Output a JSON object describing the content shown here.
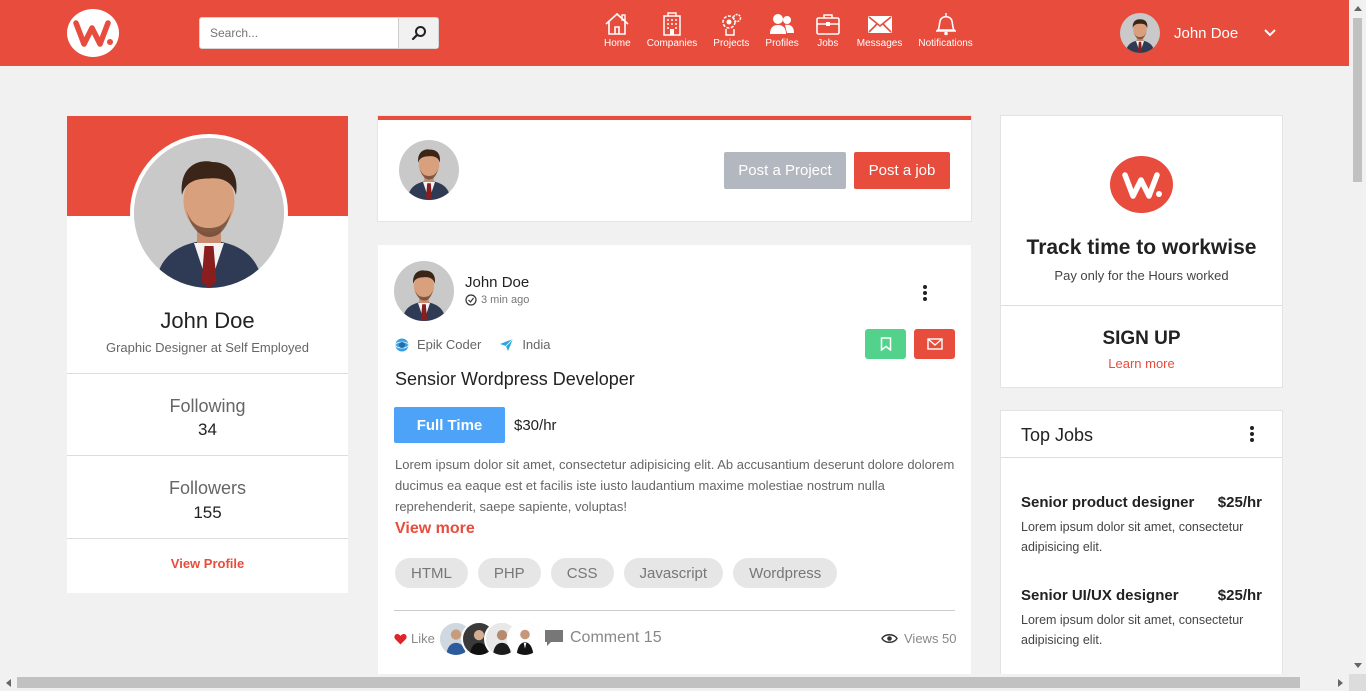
{
  "header": {
    "search_placeholder": "Search...",
    "nav": [
      {
        "label": "Home",
        "icon": "home-icon"
      },
      {
        "label": "Companies",
        "icon": "building-icon"
      },
      {
        "label": "Projects",
        "icon": "projects-icon"
      },
      {
        "label": "Profiles",
        "icon": "users-icon"
      },
      {
        "label": "Jobs",
        "icon": "briefcase-icon"
      },
      {
        "label": "Messages",
        "icon": "mail-icon"
      },
      {
        "label": "Notifications",
        "icon": "bell-icon"
      }
    ],
    "user_name": "John Doe"
  },
  "profile": {
    "name": "John Doe",
    "title": "Graphic Designer at Self Employed",
    "following_label": "Following",
    "following_count": "34",
    "followers_label": "Followers",
    "followers_count": "155",
    "view_profile": "View Profile"
  },
  "composer": {
    "post_project": "Post a Project",
    "post_job": "Post a job"
  },
  "post": {
    "author": "John Doe",
    "time": "3 min ago",
    "company": "Epik Coder",
    "location": "India",
    "title": "Sensior Wordpress Developer",
    "job_type": "Full Time",
    "rate": "$30/hr",
    "description": "Lorem ipsum dolor sit amet, consectetur adipisicing elit. Ab accusantium deserunt dolore dolorem ducimus ea eaque est et facilis iste iusto laudantium maxime molestiae nostrum nulla reprehenderit, saepe sapiente, voluptas!",
    "view_more": "View more",
    "tags": [
      "HTML",
      "PHP",
      "CSS",
      "Javascript",
      "Wordpress"
    ],
    "like_label": "Like",
    "comment_label": "Comment 15",
    "views_label": "Views 50"
  },
  "track": {
    "title": "Track time to workwise",
    "subtitle": "Pay only for the Hours worked",
    "signup": "SIGN UP",
    "learn_more": "Learn more"
  },
  "top_jobs": {
    "title": "Top Jobs",
    "jobs": [
      {
        "title": "Senior product designer",
        "rate": "$25/hr",
        "desc": "Lorem ipsum dolor sit amet, consectetur adipisicing elit."
      },
      {
        "title": "Senior UI/UX designer",
        "rate": "$25/hr",
        "desc": "Lorem ipsum dolor sit amet, consectetur adipisicing elit."
      }
    ]
  },
  "colors": {
    "brand": "#e74c3c",
    "full_time_badge": "#4da3f7",
    "save_button": "#53d28c",
    "project_button": "#b3b7bf"
  }
}
